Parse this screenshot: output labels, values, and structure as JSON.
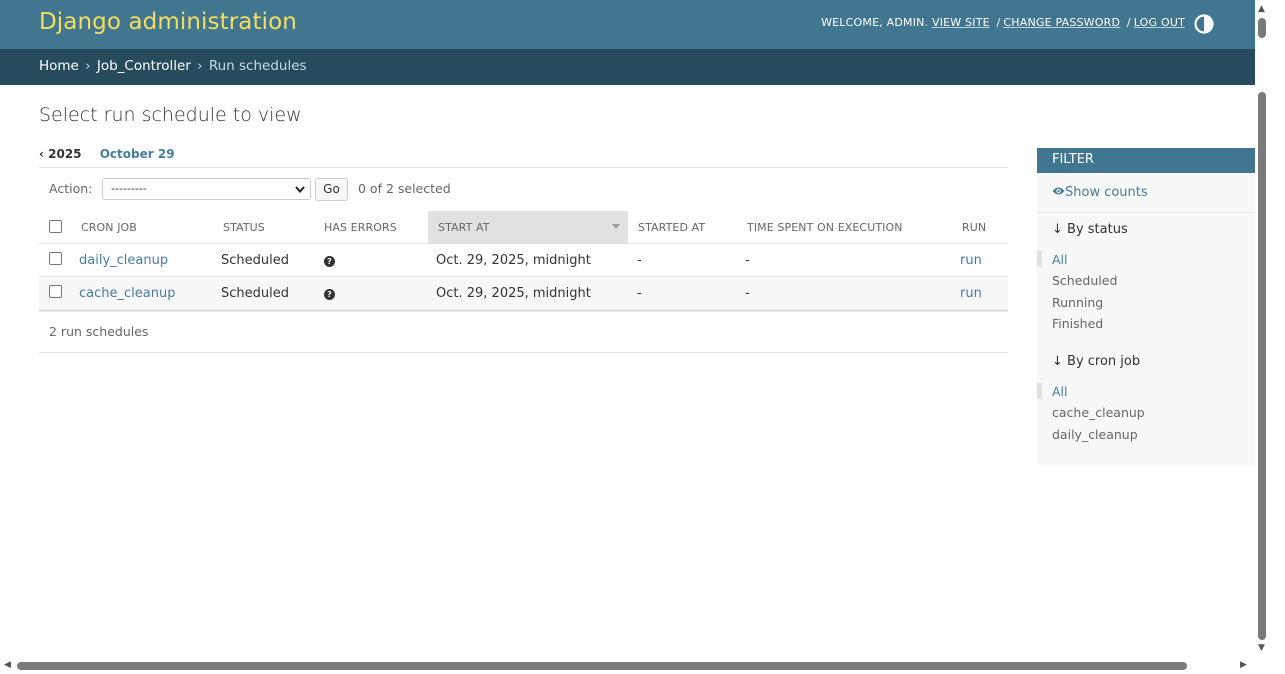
{
  "header": {
    "brand": "Django administration",
    "welcome": "Welcome, ",
    "user": "admin",
    "view_site": "View site",
    "change_password": "Change password",
    "log_out": "Log out",
    "sep": "/"
  },
  "breadcrumbs": {
    "home": "Home",
    "app": "Job_Controller",
    "current": "Run schedules",
    "sep": "›"
  },
  "page_title": "Select run schedule to view",
  "date_hierarchy": {
    "back": "‹ 2025",
    "current": "October 29"
  },
  "actions": {
    "label": "Action:",
    "selected_value": "---------",
    "go_label": "Go",
    "selection_count": "0 of 2 selected"
  },
  "table": {
    "columns": [
      "Cron job",
      "Status",
      "Has errors",
      "Start at",
      "Started at",
      "Time spent on execution",
      "Run"
    ],
    "rows": [
      {
        "cron_job": "daily_cleanup",
        "status": "Scheduled",
        "has_errors": "?",
        "start_at": "Oct. 29, 2025, midnight",
        "started_at": "-",
        "time_spent": "-",
        "run": "run"
      },
      {
        "cron_job": "cache_cleanup",
        "status": "Scheduled",
        "has_errors": "?",
        "start_at": "Oct. 29, 2025, midnight",
        "started_at": "-",
        "time_spent": "-",
        "run": "run"
      }
    ]
  },
  "paginator": "2 run schedules",
  "filter": {
    "title": "Filter",
    "show_counts": "Show counts",
    "by_status": {
      "title": "↓ By status",
      "items": [
        "All",
        "Scheduled",
        "Running",
        "Finished"
      ]
    },
    "by_cron_job": {
      "title": "↓ By cron job",
      "items": [
        "All",
        "cache_cleanup",
        "daily_cleanup"
      ]
    }
  },
  "colors": {
    "header_bg": "#417690",
    "brand": "#f5dd5d",
    "breadcrumbs_bg": "#264b5d",
    "link": "#447e9b"
  }
}
